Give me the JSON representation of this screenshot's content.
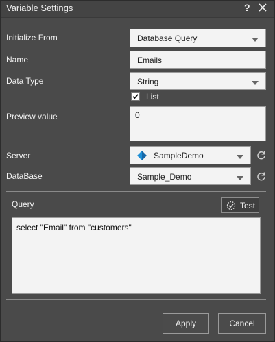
{
  "dialog": {
    "title": "Variable Settings",
    "help_glyph": "?",
    "close_icon": "close-icon"
  },
  "fields": {
    "initialize_from": {
      "label": "Initialize From",
      "value": "Database Query"
    },
    "name": {
      "label": "Name",
      "value": "Emails"
    },
    "data_type": {
      "label": "Data Type",
      "value": "String"
    },
    "list": {
      "label": "List",
      "checked": true
    },
    "preview_value": {
      "label": "Preview value",
      "value": "0"
    },
    "server": {
      "label": "Server",
      "value": "SampleDemo"
    },
    "database": {
      "label": "DataBase",
      "value": "Sample_Demo"
    }
  },
  "query": {
    "label": "Query",
    "test_label": "Test",
    "text": "select \"Email\" from \"customers\""
  },
  "buttons": {
    "apply": "Apply",
    "cancel": "Cancel"
  },
  "colors": {
    "dialog_bg": "#4a4a4a",
    "input_bg": "#f3f3f3",
    "accent_blue": "#1f8fd6"
  }
}
